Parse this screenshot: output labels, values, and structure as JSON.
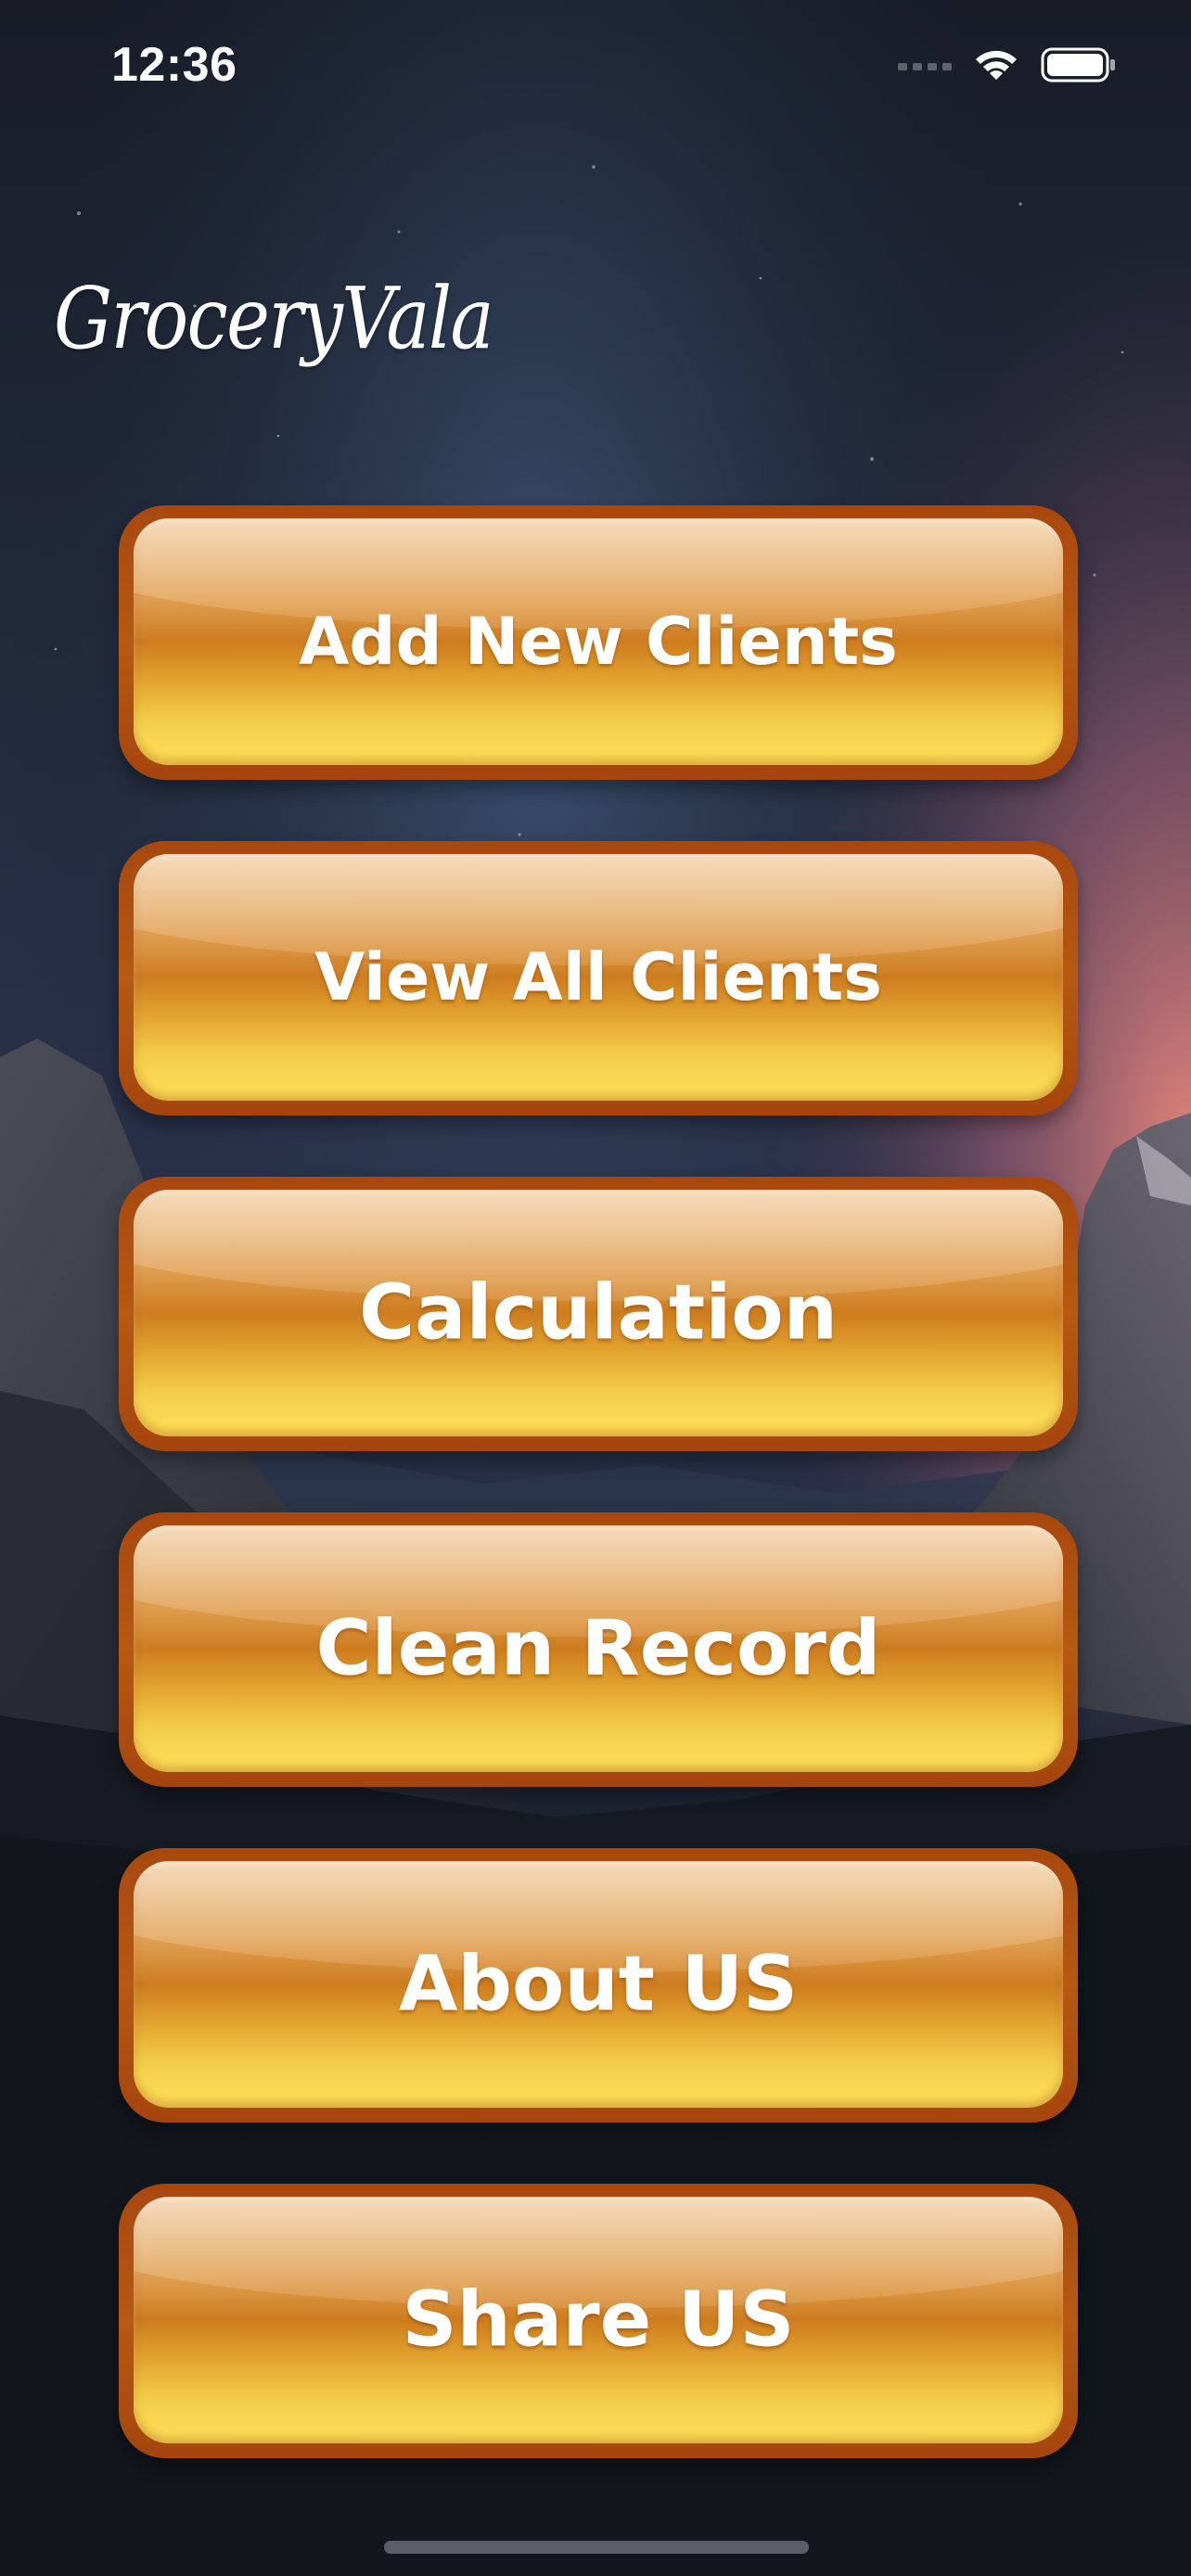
{
  "status_bar": {
    "time": "12:36",
    "icons": [
      "cellular-signal-icon",
      "wifi-icon",
      "battery-icon"
    ]
  },
  "app": {
    "title": "GroceryVala"
  },
  "menu": {
    "buttons": [
      {
        "label": "Add New Clients"
      },
      {
        "label": "View All Clients"
      },
      {
        "label": "Calculation"
      },
      {
        "label": "Clean Record"
      },
      {
        "label": "About US"
      },
      {
        "label": "Share US"
      }
    ]
  },
  "colors": {
    "button_border": "#a8480f",
    "button_top": "#f0cfa8",
    "button_mid": "#cd7c1f",
    "button_bottom": "#ffe25a",
    "background_sky": "#171c27",
    "glow_pink": "#d97a74"
  }
}
